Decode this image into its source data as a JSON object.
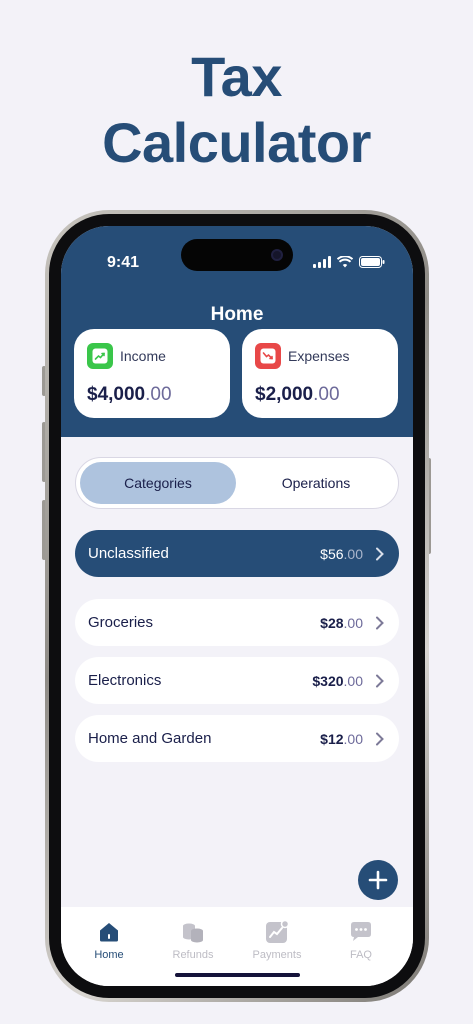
{
  "promo": {
    "title_line1": "Tax",
    "title_line2": "Calculator"
  },
  "status": {
    "time": "9:41"
  },
  "screen_title": "Home",
  "cards": {
    "income": {
      "label": "Income",
      "amount_main": "$4,000",
      "amount_cents": ".00",
      "icon": "trend-up-icon",
      "color": "#3ac64a"
    },
    "expenses": {
      "label": "Expenses",
      "amount_main": "$2,000",
      "amount_cents": ".00",
      "icon": "trend-down-icon",
      "color": "#e84848"
    }
  },
  "segments": {
    "active": "Categories",
    "inactive": "Operations"
  },
  "rows": [
    {
      "name": "Unclassified",
      "amount_main": "$56",
      "amount_cents": ".00"
    },
    {
      "name": "Groceries",
      "amount_main": "$28",
      "amount_cents": ".00"
    },
    {
      "name": "Electronics",
      "amount_main": "$320",
      "amount_cents": ".00"
    },
    {
      "name": "Home and Garden",
      "amount_main": "$12",
      "amount_cents": ".00"
    }
  ],
  "tabs": [
    {
      "label": "Home",
      "icon": "home-icon"
    },
    {
      "label": "Refunds",
      "icon": "coins-icon"
    },
    {
      "label": "Payments",
      "icon": "chart-icon"
    },
    {
      "label": "FAQ",
      "icon": "chat-icon"
    }
  ],
  "colors": {
    "primary": "#264d77",
    "background": "#f3f2f8",
    "segment_active": "#aec3de"
  }
}
